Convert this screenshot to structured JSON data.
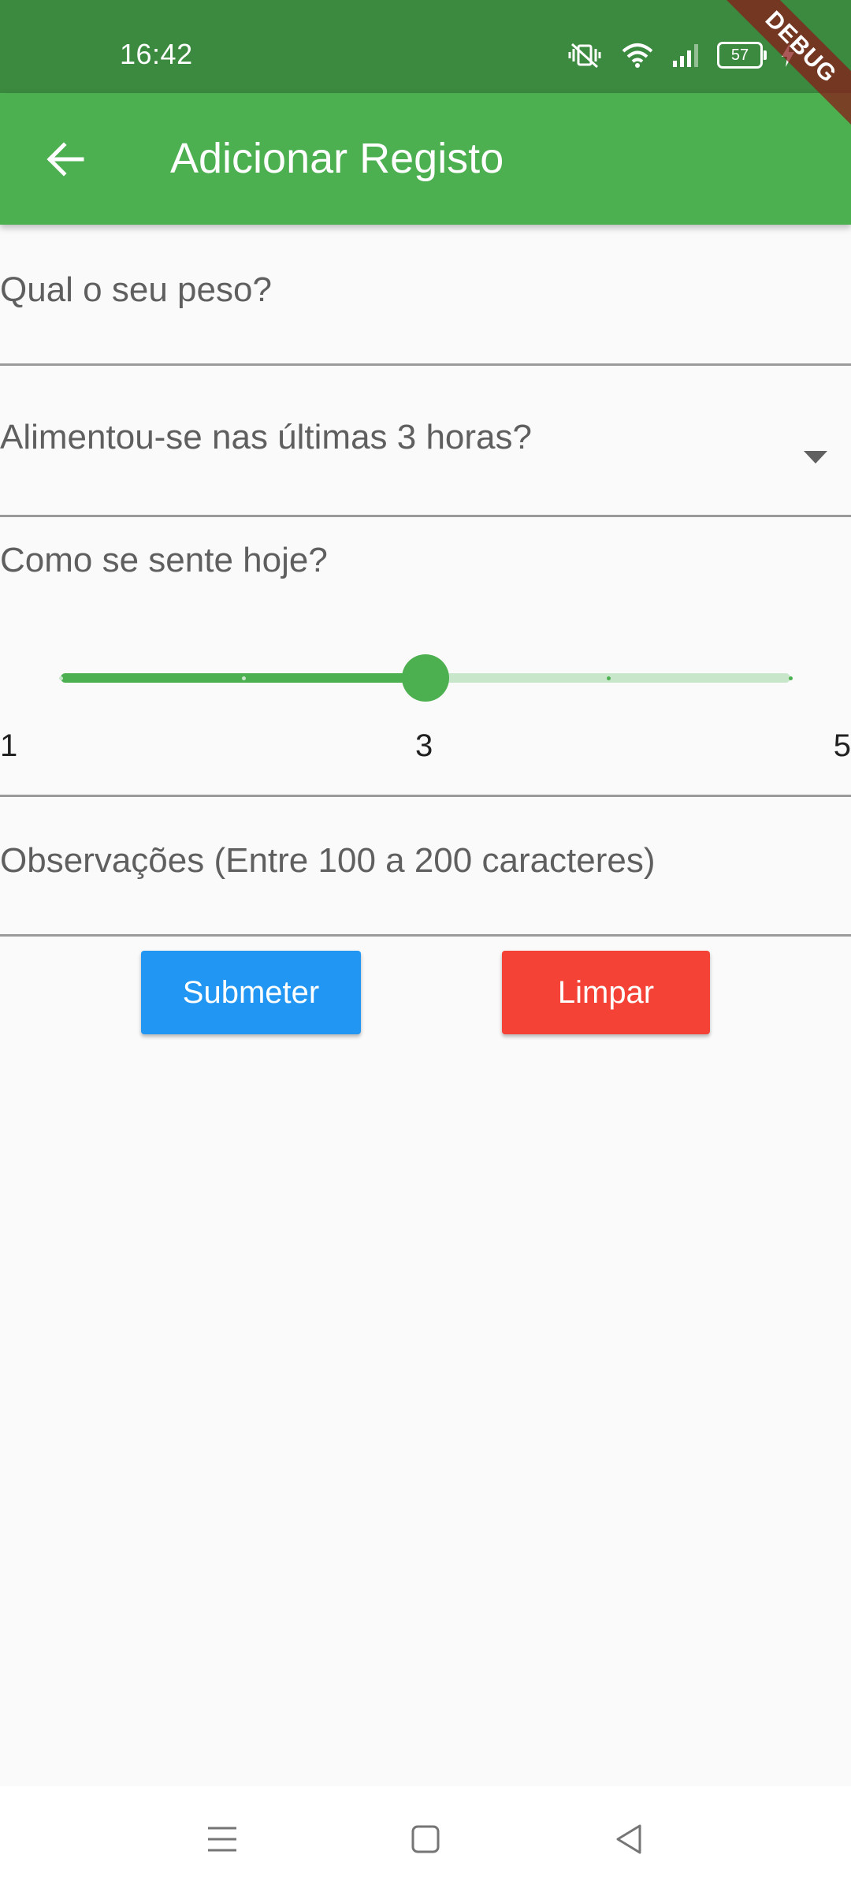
{
  "status_bar": {
    "time": "16:42",
    "battery_level": "57",
    "icons": [
      "vibrate-off-icon",
      "wifi-icon",
      "signal-icon",
      "battery-icon",
      "charging-icon"
    ]
  },
  "debug_banner": {
    "label": "DEBUG"
  },
  "app_bar": {
    "title": "Adicionar Registo",
    "back_icon": "arrow-back-icon",
    "color": "#4caf50"
  },
  "form": {
    "weight": {
      "label": "Qual o seu peso?",
      "value": ""
    },
    "fed_recently": {
      "label": "Alimentou-se nas últimas 3 horas?",
      "selected": ""
    },
    "feeling": {
      "label": "Como se sente hoje?",
      "min": 1,
      "max": 5,
      "value": 3,
      "min_label": "1",
      "value_label": "3",
      "max_label": "5",
      "active_color": "#4caf50",
      "inactive_color": "#c8e6c9"
    },
    "notes": {
      "label": "Observações (Entre 100 a 200 caracteres)",
      "value": ""
    }
  },
  "actions": {
    "submit_label": "Submeter",
    "submit_color": "#2196f3",
    "clear_label": "Limpar",
    "clear_color": "#f44336"
  },
  "nav_bar": {
    "icons": [
      "menu-icon",
      "home-icon",
      "back-triangle-icon"
    ]
  }
}
